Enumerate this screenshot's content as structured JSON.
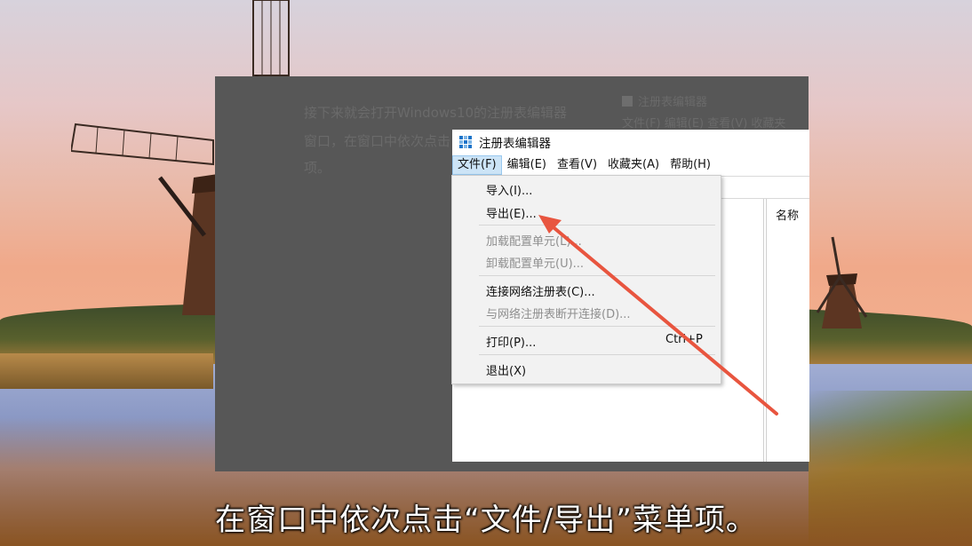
{
  "slide": {
    "ghost_lines": [
      "接下来就会打开Windows10的注册表编辑器",
      "窗口，在窗口中依次点击",
      "项。"
    ],
    "ghost_window_title": "注册表编辑器",
    "ghost_menu": "文件(F)  编辑(E)  查看(V)  收藏夹"
  },
  "window": {
    "title": "注册表编辑器",
    "app_icon": "registry-editor-icon",
    "menu": [
      {
        "label": "文件(F)",
        "active": true
      },
      {
        "label": "编辑(E)",
        "active": false
      },
      {
        "label": "查看(V)",
        "active": false
      },
      {
        "label": "收藏夹(A)",
        "active": false
      },
      {
        "label": "帮助(H)",
        "active": false
      }
    ],
    "column_header": "名称"
  },
  "file_menu": {
    "items": [
      {
        "label": "导入(I)...",
        "enabled": true
      },
      {
        "label": "导出(E)...",
        "enabled": true
      },
      {
        "label": "加载配置单元(L)...",
        "enabled": false
      },
      {
        "label": "卸载配置单元(U)...",
        "enabled": false
      },
      {
        "label": "连接网络注册表(C)...",
        "enabled": true
      },
      {
        "label": "与网络注册表断开连接(D)...",
        "enabled": false
      },
      {
        "label": "打印(P)...",
        "enabled": true,
        "shortcut": "Ctrl+P"
      },
      {
        "label": "退出(X)",
        "enabled": true
      }
    ]
  },
  "annotation": {
    "arrow_color": "#e8553f"
  },
  "subtitle": "在窗口中依次点击“文件/导出”菜单项。"
}
